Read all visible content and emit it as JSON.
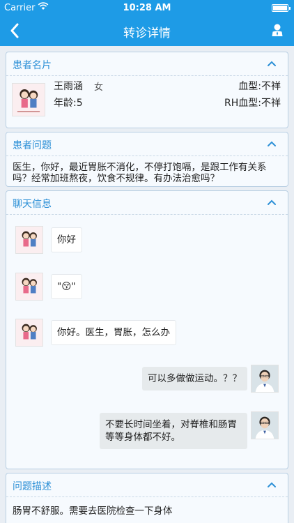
{
  "status_bar": {
    "carrier": "Carrier",
    "time": "10:28 AM"
  },
  "nav": {
    "title": "转诊详情",
    "back_icon": "chevron-left-icon",
    "user_icon": "user-icon"
  },
  "patient_card": {
    "header": "患者名片",
    "name": "王雨涵",
    "gender": "女",
    "age": "年龄:5",
    "blood_type": "血型:不祥",
    "rh_type": "RH血型:不祥"
  },
  "question_card": {
    "header": "患者问题",
    "text": "医生，你好，最近胃胀不消化，不停打饱嗝，是跟工作有关系吗？经常加班熬夜，饮食不规律。有办法治愈吗？"
  },
  "chat_card": {
    "header": "聊天信息",
    "messages": [
      {
        "from": "patient",
        "text": "你好"
      },
      {
        "from": "patient",
        "text": "\"😚\""
      },
      {
        "from": "patient",
        "text": "你好。医生，胃胀，怎么办"
      },
      {
        "from": "doctor",
        "text": "可以多做做运动。？？"
      },
      {
        "from": "doctor",
        "text": "不要长时间坐着，对脊椎和肠胃等等身体都不好。"
      }
    ]
  },
  "desc_card": {
    "header": "问题描述",
    "text": "肠胃不舒服。需要去医院检查一下身体"
  },
  "colors": {
    "accent": "#1e9be6",
    "header_text": "#2b8fd6",
    "card_bg": "#f6fafe"
  }
}
